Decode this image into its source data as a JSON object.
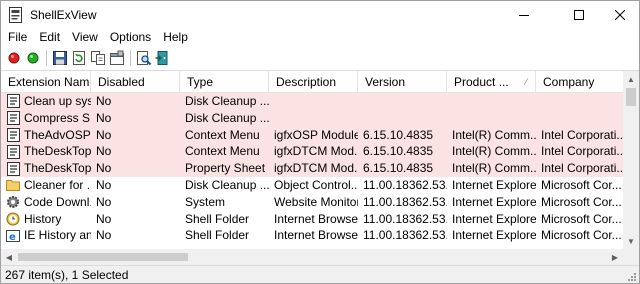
{
  "window": {
    "title": "ShellExView"
  },
  "menu": [
    "File",
    "Edit",
    "View",
    "Options",
    "Help"
  ],
  "toolbar": [
    {
      "icon": "red-circle-icon"
    },
    {
      "icon": "green-circle-icon"
    },
    {
      "icon": "save-icon"
    },
    {
      "icon": "refresh-icon"
    },
    {
      "icon": "copy-icon"
    },
    {
      "icon": "properties-icon"
    },
    {
      "icon": "find-icon"
    },
    {
      "icon": "exit-icon"
    }
  ],
  "columns": [
    "Extension Name",
    "Disabled",
    "Type",
    "Description",
    "Version",
    "Product ...",
    "Company"
  ],
  "rows": [
    {
      "name": "Clean up sys...",
      "disabled": "No",
      "type": "Disk Cleanup ...",
      "description": "",
      "version": "",
      "product": "",
      "company": "",
      "highlight": true,
      "icon": "extension-icon"
    },
    {
      "name": "Compress S...",
      "disabled": "No",
      "type": "Disk Cleanup ...",
      "description": "",
      "version": "",
      "product": "",
      "company": "",
      "highlight": true,
      "icon": "extension-icon"
    },
    {
      "name": "TheAdvOSPr...",
      "disabled": "No",
      "type": "Context Menu",
      "description": "igfxOSP Module",
      "version": "6.15.10.4835",
      "product": "Intel(R) Comm...",
      "company": "Intel Corporati...",
      "highlight": true,
      "icon": "extension-icon"
    },
    {
      "name": "TheDeskTop...",
      "disabled": "No",
      "type": "Context Menu",
      "description": "igfxDTCM Mod...",
      "version": "6.15.10.4835",
      "product": "Intel(R) Comm...",
      "company": "Intel Corporati...",
      "highlight": true,
      "icon": "extension-icon"
    },
    {
      "name": "TheDeskTop...",
      "disabled": "No",
      "type": "Property Sheet",
      "description": "igfxDTCM Mod...",
      "version": "6.15.10.4835",
      "product": "Intel(R) Comm...",
      "company": "Intel Corporati...",
      "highlight": true,
      "icon": "extension-icon"
    },
    {
      "name": "Cleaner for ...",
      "disabled": "No",
      "type": "Disk Cleanup ...",
      "description": "Object Control...",
      "version": "11.00.18362.53...",
      "product": "Internet Explorer",
      "company": "Microsoft Cor...",
      "highlight": false,
      "icon": "folder-icon"
    },
    {
      "name": "Code Downl...",
      "disabled": "No",
      "type": "System",
      "description": "Website Monitor",
      "version": "11.00.18362.53...",
      "product": "Internet Explorer",
      "company": "Microsoft Cor...",
      "highlight": false,
      "icon": "gear-icon"
    },
    {
      "name": "History",
      "disabled": "No",
      "type": "Shell Folder",
      "description": "Internet Browser",
      "version": "11.00.18362.53...",
      "product": "Internet Explorer",
      "company": "Microsoft Cor...",
      "highlight": false,
      "icon": "history-icon"
    },
    {
      "name": "IE History an...",
      "disabled": "No",
      "type": "Shell Folder",
      "description": "Internet Browser",
      "version": "11.00.18362.53...",
      "product": "Internet Explorer",
      "company": "Microsoft Cor...",
      "highlight": false,
      "icon": "ie-icon"
    }
  ],
  "status": {
    "text": "267 item(s), 1 Selected"
  }
}
